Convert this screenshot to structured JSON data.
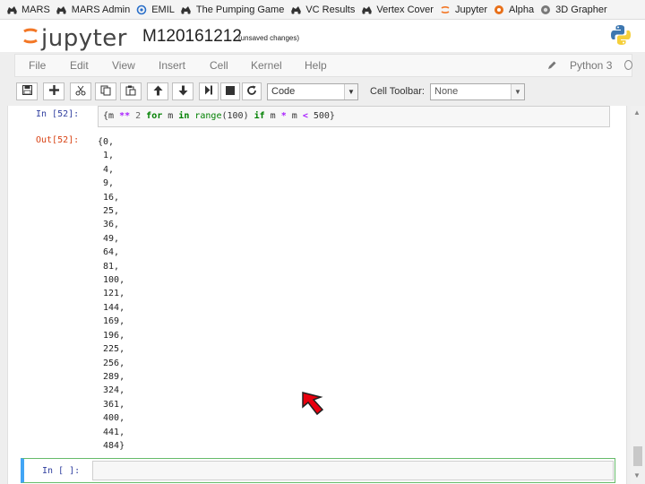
{
  "bookmarks": [
    {
      "label": "MARS",
      "icon": "mars-icon"
    },
    {
      "label": "MARS Admin",
      "icon": "mars-icon"
    },
    {
      "label": "EMIL",
      "icon": "emil-icon"
    },
    {
      "label": "The Pumping Game",
      "icon": "mars-icon"
    },
    {
      "label": "VC Results",
      "icon": "mars-icon"
    },
    {
      "label": "Vertex Cover",
      "icon": "mars-icon"
    },
    {
      "label": "Jupyter",
      "icon": "jupyter-icon"
    },
    {
      "label": "Alpha",
      "icon": "alpha-icon"
    },
    {
      "label": "3D Grapher",
      "icon": "grapher-icon"
    }
  ],
  "header": {
    "logo_text": "jupyter",
    "notebook_name": "M120161212",
    "save_status": "(unsaved changes)"
  },
  "menu": {
    "items": [
      "File",
      "Edit",
      "View",
      "Insert",
      "Cell",
      "Kernel",
      "Help"
    ],
    "kernel_name": "Python 3"
  },
  "toolbar": {
    "cell_type": "Code",
    "cell_toolbar_label": "Cell Toolbar:",
    "cell_toolbar_value": "None"
  },
  "cells": {
    "input_prompt": "In [52]:",
    "code_parts": [
      "{m ",
      "**",
      " 2 ",
      "for",
      " m ",
      "in",
      " ",
      "range",
      "(100) ",
      "if",
      " m ",
      "*",
      " m ",
      "<",
      " 500}"
    ],
    "output_prompt": "Out[52]:",
    "output_lines": [
      "{0,",
      " 1,",
      " 4,",
      " 9,",
      " 16,",
      " 25,",
      " 36,",
      " 49,",
      " 64,",
      " 81,",
      " 100,",
      " 121,",
      " 144,",
      " 169,",
      " 196,",
      " 225,",
      " 256,",
      " 289,",
      " 324,",
      " 361,",
      " 400,",
      " 441,",
      " 484}"
    ],
    "new_prompt": "In [ ]:"
  }
}
